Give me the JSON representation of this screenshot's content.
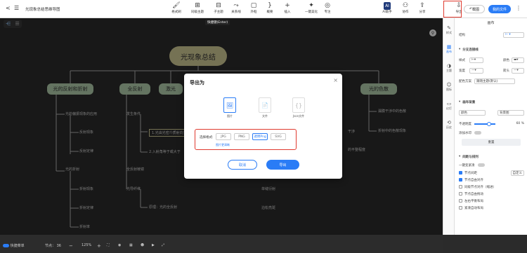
{
  "app": {
    "title": "光现象总结思维导图",
    "menu": "☰",
    "back": "<"
  },
  "toolbar": {
    "items": [
      {
        "label": "格式刷",
        "icon": "🖌"
      },
      {
        "label": "同级主题",
        "icon": "⊞"
      },
      {
        "label": "子主题",
        "icon": "⊟"
      },
      {
        "label": "关系线",
        "icon": "⤳"
      },
      {
        "label": "外框",
        "icon": "▢"
      },
      {
        "label": "概要",
        "icon": "}"
      },
      {
        "label": "插入",
        "icon": "+"
      },
      {
        "label": "一键美化",
        "icon": "✦"
      },
      {
        "label": "专注",
        "icon": "◎"
      },
      {
        "label": "AI助手",
        "icon": "AI"
      },
      {
        "label": "协作",
        "icon": "⚇"
      },
      {
        "label": "分享",
        "icon": "⇪"
      },
      {
        "label": "导出",
        "icon": "⇩"
      }
    ],
    "tooltip": "快捷键(Enter)",
    "btn_back": "截图",
    "btn_files": "我的文件"
  },
  "mindmap": {
    "root": "光现象总结",
    "branches": [
      "光的反射和折射",
      "全反射",
      "激光",
      "光的色散"
    ],
    "nodes": [
      "光的偏振现象的应用",
      "反射现象",
      "反射定律",
      "光的折射",
      "折射现象",
      "折射定律",
      "折射率",
      "发生条件",
      "1.光由光密介质射向光疏介质",
      "2.入射角等于或大于",
      "全反射棱镜",
      "光导纤维",
      "原理：光的全反射",
      "漏膜干涉中的色散",
      "折射中的色散现象",
      "干涉",
      "的平整程度",
      "单缝衍射",
      "泊松亮斑"
    ]
  },
  "dialog": {
    "title": "导出为",
    "close": "×",
    "types": [
      {
        "label": "图片",
        "icon": "🖼"
      },
      {
        "label": "文件",
        "icon": "📄"
      },
      {
        "label": "Json文件",
        "icon": "{}"
      }
    ],
    "format_label": "选择格式:",
    "formats": [
      "JPG",
      "PNG",
      "透明Png",
      "SVG"
    ],
    "selected_format": "透明Png",
    "clear_link": "图片更清晰",
    "cancel": "取消",
    "confirm": "导出"
  },
  "panel": {
    "header": "画布",
    "tabs": [
      {
        "label": "样式",
        "icon": "✎"
      },
      {
        "label": "画布",
        "icon": "▦"
      },
      {
        "label": "主题",
        "icon": "◑"
      },
      {
        "label": "图标",
        "icon": "☺"
      },
      {
        "label": "幻灯",
        "icon": "▭"
      },
      {
        "label": "历史",
        "icon": "⟲"
      }
    ],
    "structure_label": "结构",
    "branch_title": "分支连接线",
    "style_label": "样式",
    "color_label": "颜色",
    "width_label": "宽度",
    "color_scheme_label": "配色方案",
    "color_scheme_value": "跟随主题(默认)",
    "bg_title": "画布背景",
    "bg_color_label": "颜色",
    "bg_image_label": "背景图",
    "opacity_label": "不透明度",
    "opacity_value": "60 %",
    "watermark_label": "添加水印",
    "reset": "重置",
    "layout_title": "间距与排列",
    "one_key": "一键变紧凑",
    "node_spacing": "节点间距",
    "custom": "自定义",
    "checks": [
      {
        "label": "节点自由对齐",
        "on": true
      },
      {
        "label": "同级节点对齐（缩进）",
        "on": false
      },
      {
        "label": "节点自由拖动",
        "on": false
      },
      {
        "label": "左右平衡布局",
        "on": false
      },
      {
        "label": "紧凑自动布局",
        "on": false
      }
    ]
  },
  "bottom": {
    "shortcut": "快捷菜单",
    "nodes_label": "节点：",
    "nodes_count": "36",
    "zoom": "125%"
  }
}
